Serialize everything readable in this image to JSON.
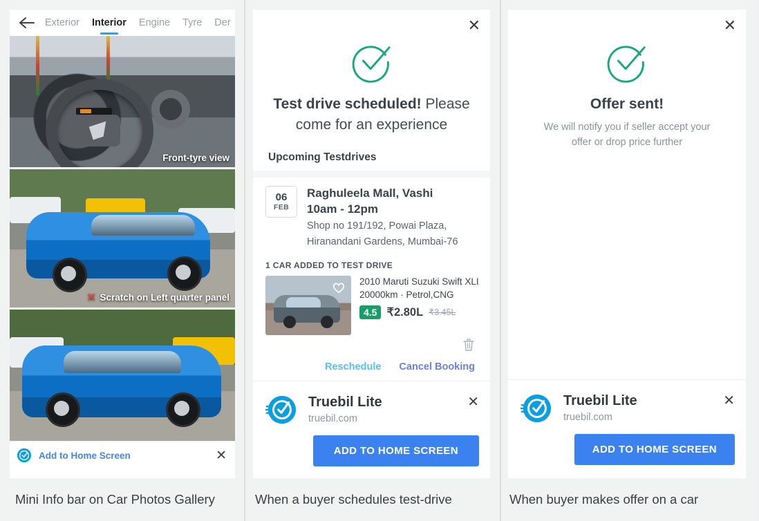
{
  "panel1": {
    "caption": "Mini Info bar on Car Photos Gallery",
    "back_icon": "back-arrow-icon",
    "tabs": [
      {
        "label": "Exterior",
        "active": false
      },
      {
        "label": "Interior",
        "active": true
      },
      {
        "label": "Engine",
        "active": false
      },
      {
        "label": "Tyre",
        "active": false
      },
      {
        "label": "Der",
        "active": false
      }
    ],
    "photos": [
      {
        "caption": "Front-tyre view",
        "has_x": false
      },
      {
        "caption": "Scratch on Left quarter panel",
        "has_x": true
      },
      {
        "caption": "",
        "has_x": false
      }
    ],
    "home_bar": {
      "icon": "truebil-logo-icon",
      "label": "Add to Home Screen",
      "close_icon": "close-icon"
    }
  },
  "panel2": {
    "caption": "When a buyer schedules test-drive",
    "close_icon": "close-icon",
    "check_icon": "success-check-icon",
    "headline_bold": "Test drive scheduled!",
    "headline_rest": " Please come for an experience",
    "section_title": "Upcoming Testdrives",
    "testdrive": {
      "date_day": "06",
      "date_month": "FEB",
      "place": "Raghuleela Mall, Vashi",
      "time": "10am - 12pm",
      "address_line1": "Shop no 191/192, Powai Plaza,",
      "address_line2": "Hiranandani Gardens, Mumbai-76"
    },
    "cars_label": "1 CAR ADDED TO TEST DRIVE",
    "car": {
      "title": "2010 Maruti Suzuki Swift XLI...",
      "specs": "20000km · Petrol,CNG",
      "rating": "4.5",
      "price": "₹2.80L",
      "price_old": "₹3.45L",
      "favorite_icon": "heart-icon",
      "delete_icon": "trash-icon"
    },
    "actions": {
      "reschedule": "Reschedule",
      "cancel": "Cancel Booking"
    },
    "install": {
      "icon": "truebil-logo-icon",
      "title": "Truebil Lite",
      "url": "truebil.com",
      "button": "ADD TO HOME SCREEN",
      "close_icon": "close-icon"
    }
  },
  "panel3": {
    "caption": "When buyer makes offer on a car",
    "close_icon": "close-icon",
    "check_icon": "success-check-icon",
    "headline": "Offer sent!",
    "sub_line1": "We will notify you if seller accept your",
    "sub_line2": "offer or drop price further",
    "install": {
      "icon": "truebil-logo-icon",
      "title": "Truebil Lite",
      "url": "truebil.com",
      "button": "ADD TO HOME SCREEN",
      "close_icon": "close-icon"
    }
  },
  "colors": {
    "accent_blue": "#3b82f0",
    "link_blue": "#4285f4",
    "success_green": "#15a97a",
    "rating_green": "#1a9e68",
    "tab_underline": "#1aa3ff",
    "reschedule": "#5bbdf2",
    "cancel": "#6b7fe8",
    "logo_cyan": "#0b9fe0",
    "background": "#f1f2f2"
  }
}
